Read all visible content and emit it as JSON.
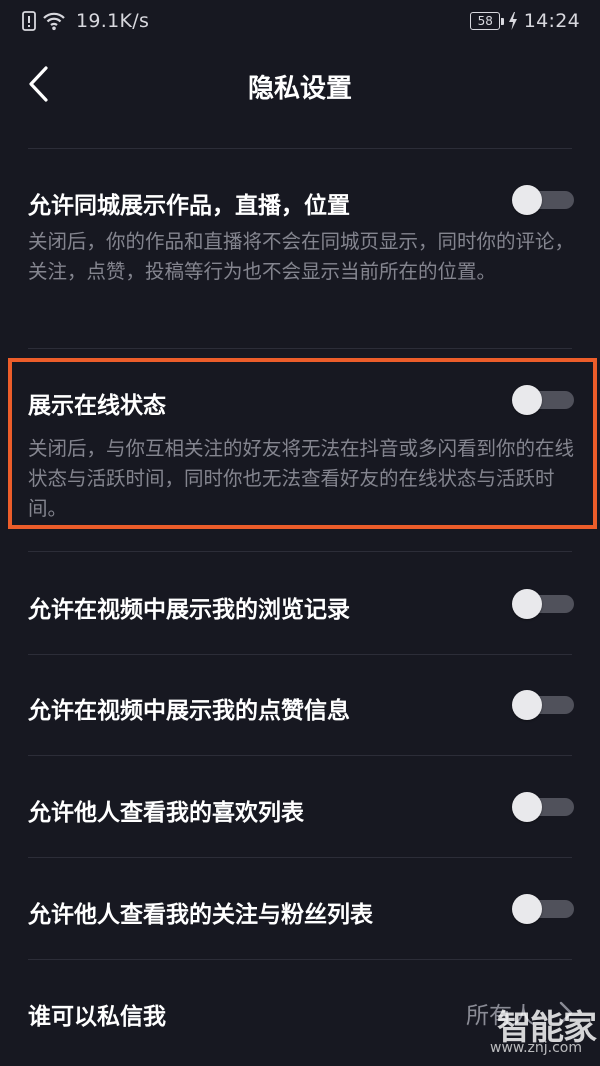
{
  "status_bar": {
    "network_speed": "19.1K/s",
    "battery_level": "58",
    "time": "14:24",
    "icons": [
      "alert-icon",
      "wifi-icon",
      "battery-icon",
      "charging-icon"
    ]
  },
  "nav": {
    "back_icon": "chevron-left-icon",
    "title": "隐私设置"
  },
  "settings": [
    {
      "title": "允许同城展示作品，直播，位置",
      "description": "关闭后，你的作品和直播将不会在同城页显示，同时你的评论，关注，点赞，投稿等行为也不会显示当前所在的位置。",
      "toggle_on": false
    },
    {
      "title": "展示在线状态",
      "description": "关闭后，与你互相关注的好友将无法在抖音或多闪看到你的在线状态与活跃时间，同时你也无法查看好友的在线状态与活跃时间。",
      "toggle_on": false,
      "highlighted": true
    },
    {
      "title": "允许在视频中展示我的浏览记录",
      "toggle_on": false
    },
    {
      "title": "允许在视频中展示我的点赞信息",
      "toggle_on": false
    },
    {
      "title": "允许他人查看我的喜欢列表",
      "toggle_on": false
    },
    {
      "title": "允许他人查看我的关注与粉丝列表",
      "toggle_on": false
    },
    {
      "title": "谁可以私信我",
      "value": "所有人"
    }
  ],
  "watermark": {
    "main": "智能家",
    "sub": "www.znj.com"
  },
  "colors": {
    "background": "#171821",
    "highlight_border": "#ec5d2a",
    "toggle_track_off": "#50515b",
    "toggle_knob": "#e9e9ec",
    "description_text": "#84858f"
  }
}
